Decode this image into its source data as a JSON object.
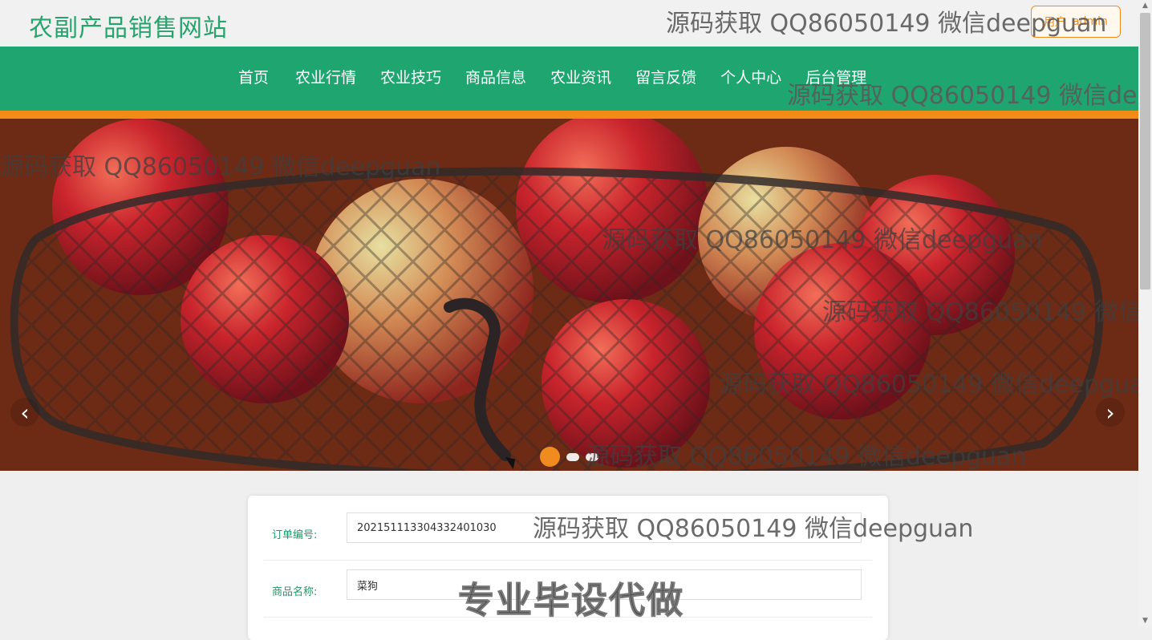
{
  "header": {
    "site_title": "农副产品销售网站",
    "user_role": "用户",
    "username": "admin"
  },
  "nav": {
    "items": [
      "首页",
      "农业行情",
      "农业技巧",
      "商品信息",
      "农业资讯",
      "留言反馈",
      "个人中心",
      "后台管理"
    ]
  },
  "banner": {
    "left_arrow_icon": "chevron-left-icon",
    "right_arrow_icon": "chevron-right-icon",
    "active_slide": 1,
    "slide_count": 3
  },
  "form": {
    "order_label": "订单编号:",
    "order_value": "202151113304332401030",
    "product_label": "商品名称:",
    "product_value": "菜狗"
  },
  "watermarks": {
    "text": "源码获取 QQ86050149 微信deepguan",
    "service": "专业毕设代做"
  },
  "colors": {
    "brand_green": "#1fa56f",
    "accent_orange": "#f28c16"
  }
}
